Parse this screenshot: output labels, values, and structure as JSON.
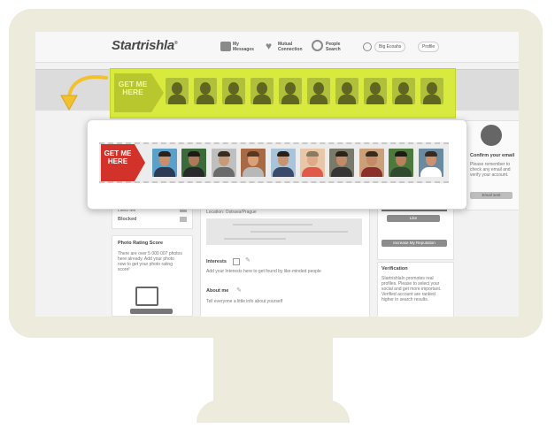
{
  "header": {
    "logo": "Startrishla",
    "logo_mark": "®",
    "nav": [
      {
        "icon": "messages-icon",
        "label": "My Messages"
      },
      {
        "icon": "heart-icon",
        "label": "Mutual Connection"
      },
      {
        "icon": "search-icon",
        "label": "People Search"
      }
    ],
    "pills": [
      {
        "icon": "coin-icon",
        "label": "Big Ecoahs"
      },
      {
        "icon": "menu-icon",
        "label": "Profile"
      }
    ]
  },
  "promo": {
    "lime_tag": "GET ME HERE",
    "tag": "GET ME HERE",
    "face_count": 10,
    "faces": [
      {
        "bg": "#5aa0c8",
        "skin": "#c98e6e",
        "hair": "#2c2018",
        "shirt": "#2b3a55"
      },
      {
        "bg": "#3c6a3a",
        "skin": "#b07a5a",
        "hair": "#1f1a14",
        "shirt": "#2a2a2a"
      },
      {
        "bg": "#bfbfbf",
        "skin": "#c99a78",
        "hair": "#3b2c20",
        "shirt": "#6b6b6b"
      },
      {
        "bg": "#a86a45",
        "skin": "#d9a07a",
        "hair": "#5a3820",
        "shirt": "#b8b8b8"
      },
      {
        "bg": "#a9c4d8",
        "skin": "#c7946f",
        "hair": "#2a2018",
        "shirt": "#3a4a6a"
      },
      {
        "bg": "#e8c7a8",
        "skin": "#e0aa88",
        "hair": "#8a7a60",
        "shirt": "#e05a4a"
      },
      {
        "bg": "#7a7a6a",
        "skin": "#c18b66",
        "hair": "#2b2218",
        "shirt": "#353535"
      },
      {
        "bg": "#c9a07a",
        "skin": "#c58b66",
        "hair": "#3a2a1c",
        "shirt": "#8a2f2a"
      },
      {
        "bg": "#4d7a3c",
        "skin": "#b9805d",
        "hair": "#1e1a14",
        "shirt": "#2f4a2f"
      },
      {
        "bg": "#6a8aa0",
        "skin": "#c99270",
        "hair": "#3a2a1e",
        "shirt": "#ffffff"
      }
    ]
  },
  "sidebar": {
    "items": [
      "Liked Me",
      "Blocked"
    ],
    "photo_rating_title": "Photo Rating Score",
    "photo_rating_text": "There are over 5 000 007 photos here already. Add your photo now to get your photo rating score!"
  },
  "main": {
    "location_label": "Location: Ostrava/Prague",
    "interests_label": "Interests",
    "interests_hint": "Add your Interests here to get found by like-minded people",
    "about_label": "About me",
    "about_hint": "Tell everyone a little info about yourself"
  },
  "right": {
    "confirm_title": "Confirm your email",
    "confirm_text": "Please remember to check any email and verify your account.",
    "email_button": "Email sent",
    "like_button": "Like",
    "increase_button": "Increase My Reputation",
    "verification_title": "Verification",
    "verification_text": "StartrishlaIn promotes real profiles. Please to select your social and get more important. Verified account are ranked higher in search results."
  },
  "colors": {
    "accent_lime": "#d9ea3e",
    "accent_red": "#d2322a",
    "monitor": "#ecebdc",
    "arrow": "#f2c12e"
  }
}
